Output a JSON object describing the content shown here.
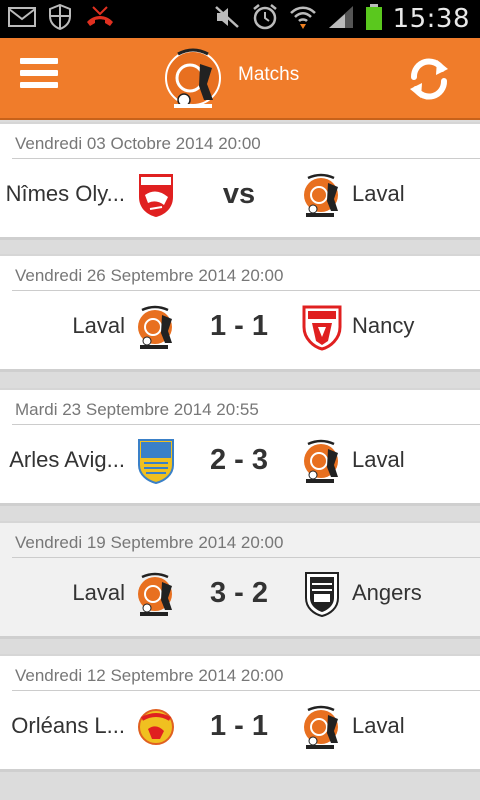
{
  "status_bar": {
    "time": "15:38",
    "icons": [
      "mail-icon",
      "shield-icon",
      "missed-call-icon",
      "mute-icon",
      "alarm-icon",
      "wifi-icon",
      "signal-icon",
      "battery-icon"
    ]
  },
  "app_bar": {
    "title": "Matchs",
    "menu_icon": "hamburger-menu-icon",
    "refresh_icon": "refresh-icon",
    "colors": {
      "bar": "#f07c2a",
      "accent": "#f07c2a"
    }
  },
  "matches": [
    {
      "date": "Vendredi 03 Octobre 2014 20:00",
      "home": "Nîmes Oly...",
      "away": "Laval",
      "score": "vs"
    },
    {
      "date": "Vendredi 26 Septembre 2014 20:00",
      "home": "Laval",
      "away": "Nancy",
      "score": "1 - 1"
    },
    {
      "date": "Mardi 23 Septembre 2014 20:55",
      "home": "Arles Avig...",
      "away": "Laval",
      "score": "2 - 3"
    },
    {
      "date": "Vendredi 19 Septembre 2014 20:00",
      "home": "Laval",
      "away": "Angers",
      "score": "3 - 2"
    },
    {
      "date": "Vendredi 12 Septembre 2014 20:00",
      "home": "Orléans L...",
      "away": "Laval",
      "score": "1 - 1"
    }
  ]
}
